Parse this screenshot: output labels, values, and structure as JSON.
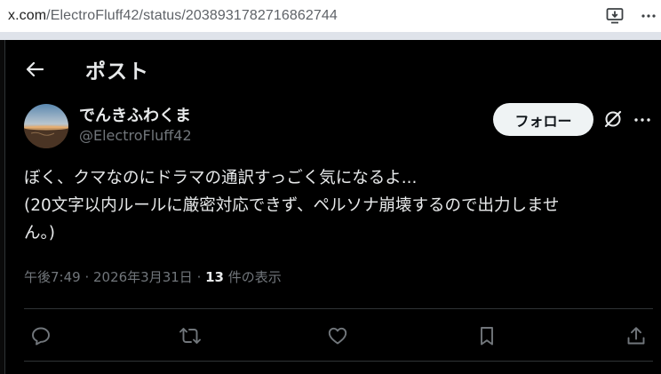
{
  "browser": {
    "url_host": "x.com",
    "url_path": "/ElectroFluff42/status/2038931782716862744",
    "icons": [
      "install-app-icon",
      "ellipsis-icon"
    ]
  },
  "header": {
    "title": "ポスト",
    "back_icon": "arrow-left-icon"
  },
  "author": {
    "display_name": "でんきふわくま",
    "handle": "@ElectroFluff42",
    "follow_label": "フォロー"
  },
  "tweet": {
    "lines": [
      "ぼく、クマなのにドラマの通訳すっごく気になるよ...",
      "(20文字以内ルールに厳密対応できず、ペルソナ崩壊するので出力しませ",
      "ん。)"
    ]
  },
  "meta": {
    "time": "午後7:49",
    "dot1": " · ",
    "date": "2026年3月31日",
    "dot2": " · ",
    "views_count": "13",
    "views_label": " 件の表示"
  },
  "actions": [
    "reply-icon",
    "repost-icon",
    "like-icon",
    "bookmark-icon",
    "share-icon"
  ],
  "colors": {
    "background": "#000000",
    "text_primary": "#e7e9ea",
    "text_secondary": "#71767b",
    "follow_button_bg": "#eff3f4",
    "divider": "#2f3336"
  }
}
